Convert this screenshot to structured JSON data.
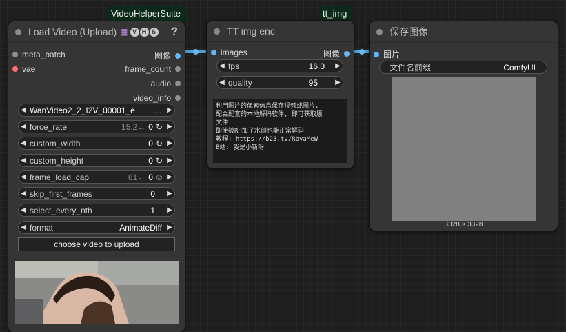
{
  "badges": {
    "vhs": "VideoHelperSuite",
    "ttimg": "tt_img"
  },
  "colors": {
    "image_slot": "#64b5f6",
    "vae_slot": "#ff6e6e",
    "link": "#4aa3df",
    "badge_bg": "#0c2a1a"
  },
  "load_video": {
    "title": "Load Video (Upload)",
    "badge_letters": [
      "V",
      "H",
      "S"
    ],
    "help": "?",
    "inputs": [
      "meta_batch",
      "vae"
    ],
    "outputs": [
      "图像",
      "frame_count",
      "audio",
      "video_info"
    ],
    "video_name": "WanVideo2_2_I2V_00001_e",
    "video_ellipsis": "…",
    "widgets": [
      {
        "label": "force_rate",
        "dim": "15.2←",
        "value": "0",
        "icon": "↻"
      },
      {
        "label": "custom_width",
        "dim": "",
        "value": "0",
        "icon": "↻"
      },
      {
        "label": "custom_height",
        "dim": "",
        "value": "0",
        "icon": "↻"
      },
      {
        "label": "frame_load_cap",
        "dim": "81←",
        "value": "0",
        "icon": "⊘"
      },
      {
        "label": "skip_first_frames",
        "dim": "",
        "value": "0",
        "icon": ""
      },
      {
        "label": "select_every_nth",
        "dim": "",
        "value": "1",
        "icon": ""
      },
      {
        "label": "format",
        "dim": "",
        "value": "AnimateDiff",
        "icon": ""
      }
    ],
    "upload_label": "choose video to upload"
  },
  "tt_node": {
    "title": "TT img enc",
    "input": "images",
    "output": "图像",
    "fps_label": "fps",
    "fps_value": "16.0",
    "quality_label": "quality",
    "quality_value": "95",
    "text_lines": [
      "利用图片的像素信息保存视频或图片,",
      "配合配套的本地解码软件, 即可获取原",
      "文件",
      "即使被RH加了水印也能正常解码",
      "教程: https://b23.tv/RbvaMeW",
      "B站: 我是小新呀"
    ]
  },
  "save_node": {
    "title": "保存图像",
    "input": "图片",
    "prefix_label": "文件名前缀",
    "prefix_value": "ComfyUI",
    "image_size": "3328 × 3328"
  }
}
